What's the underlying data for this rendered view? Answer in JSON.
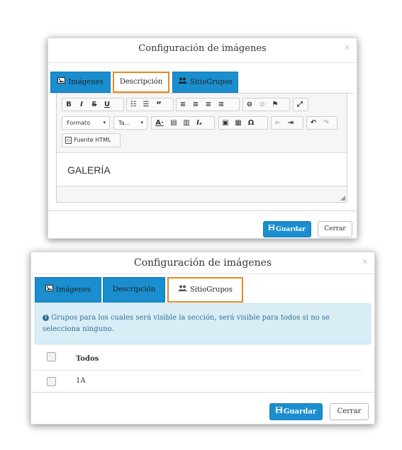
{
  "modal1": {
    "title": "Configuración de imágenes",
    "close": "×",
    "tabs": [
      {
        "label": "Imágenes",
        "icon": "image-icon",
        "active": false
      },
      {
        "label": "Descripción",
        "icon": "",
        "active": true
      },
      {
        "label": "SitioGrupos",
        "icon": "users-icon",
        "active": false
      }
    ],
    "editor": {
      "format_label": "Formato",
      "size_label": "Ta...",
      "source_label": "Fuente HTML",
      "content": "GALERÍA"
    },
    "save_label": "Guardar",
    "close_label": "Cerrar"
  },
  "modal2": {
    "title": "Configuración de imágenes",
    "close": "×",
    "tabs": [
      {
        "label": "Imágenes",
        "icon": "image-icon",
        "active": false
      },
      {
        "label": "Descripción",
        "icon": "",
        "active": false
      },
      {
        "label": "SitioGrupos",
        "icon": "users-icon",
        "active": true
      }
    ],
    "info_text": "Grupos para los cuales será visible la sección, será visible para todos si no se selecciona ninguno.",
    "table": {
      "header": "Todos",
      "rows": [
        "1A"
      ]
    },
    "save_label": "Guardar",
    "close_label": "Cerrar"
  },
  "colors": {
    "primary": "#1a8ecf",
    "active_tab_border": "#e58a1f",
    "info_bg": "#d9edf7"
  }
}
